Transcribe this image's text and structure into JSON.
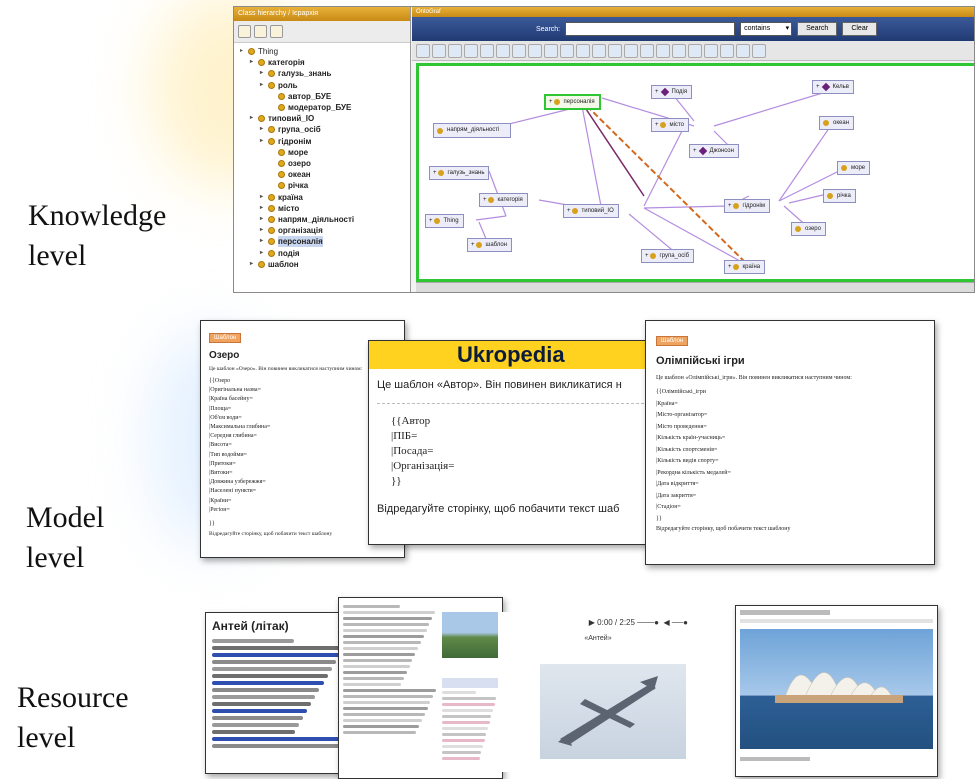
{
  "levels": {
    "knowledge": "Knowledge\nlevel",
    "model": "Model\nlevel",
    "resource": "Resource\nlevel"
  },
  "ontology_editor": {
    "tree_title": "Class hierarchy / Ієрархія",
    "graph_title": "OntoGraf",
    "tree": [
      {
        "label": "Thing",
        "depth": 0,
        "bold": false
      },
      {
        "label": "категорія",
        "depth": 1,
        "bold": true
      },
      {
        "label": "галузь_знань",
        "depth": 2,
        "bold": true
      },
      {
        "label": "роль",
        "depth": 2,
        "bold": true
      },
      {
        "label": "автор_БУЕ",
        "depth": 3,
        "bold": true
      },
      {
        "label": "модератор_БУЕ",
        "depth": 3,
        "bold": true
      },
      {
        "label": "типовий_IO",
        "depth": 1,
        "bold": true
      },
      {
        "label": "група_осіб",
        "depth": 2,
        "bold": true
      },
      {
        "label": "гідронім",
        "depth": 2,
        "bold": true
      },
      {
        "label": "море",
        "depth": 3,
        "bold": true
      },
      {
        "label": "озеро",
        "depth": 3,
        "bold": true
      },
      {
        "label": "океан",
        "depth": 3,
        "bold": true
      },
      {
        "label": "річка",
        "depth": 3,
        "bold": true
      },
      {
        "label": "країна",
        "depth": 2,
        "bold": true
      },
      {
        "label": "місто",
        "depth": 2,
        "bold": true
      },
      {
        "label": "напрям_діяльності",
        "depth": 2,
        "bold": true
      },
      {
        "label": "організація",
        "depth": 2,
        "bold": true
      },
      {
        "label": "персоналія",
        "depth": 2,
        "bold": true,
        "selected": true
      },
      {
        "label": "подія",
        "depth": 2,
        "bold": true
      },
      {
        "label": "шаблон",
        "depth": 1,
        "bold": true
      }
    ],
    "search_label": "Search:",
    "search_mode": "contains",
    "search_button": "Search",
    "clear_button": "Clear",
    "nodes": {
      "personalia": "персоналія",
      "podiya": "Подія",
      "kelvin": "Кельв",
      "napriam": "напрям_діяльності",
      "misto": "місто",
      "okean": "океан",
      "dzhonson": "Джонсон",
      "haluz": "галузь_знань",
      "more": "море",
      "kategoriya": "категорія",
      "typovyi": "типовий_IO",
      "richka": "річка",
      "thing": "Thing",
      "hidronim": "гідронім",
      "ozero": "озеро",
      "shablon": "шаблон",
      "hrupa": "група_осіб",
      "kraina": "країна"
    }
  },
  "templates": {
    "ozero": {
      "badge": "Шаблон",
      "title": "Озеро",
      "intro": "Це шаблон «Озеро». Він повинен викликатися наступним чином:",
      "lines": [
        "{{Озеро",
        "|Оригінальна назва=",
        "|Країна басейну=",
        "|Площа=",
        "|Об'єм води=",
        "|Максимальна глибина=",
        "|Середня глибина=",
        "|Висота=",
        "|Тип водойми=",
        "|Притоки=",
        "|Витоки=",
        "|Довжина узбережжя=",
        "|Населені пункти=",
        "|Країни=",
        "|Регіон="
      ],
      "close": "}}",
      "footer": "Відредагуйте сторінку, щоб побачити текст шаблону"
    },
    "avtor": {
      "banner": "Ukropedia",
      "intro": "Це шаблон «Автор». Він повинен викликатися н",
      "lines": [
        "{{Автор",
        "|ПІБ=",
        "|Посада=",
        "|Організація="
      ],
      "close": "}}",
      "footer": "Відредагуйте сторінку, щоб побачити текст шаб"
    },
    "olimp": {
      "badge": "Шаблон",
      "title": "Олімпійські ігри",
      "intro": "Це шаблон «Олімпійські_ігри». Він повинен викликатися наступним чином:",
      "lines": [
        "{{Олімпійські_ігри",
        "|Країна=",
        "|Місто-організатор=",
        "|Місто проведення=",
        "|Кількість країн-учасниць=",
        "|Кількість спортсменів=",
        "|Кількість видів спорту=",
        "|Рекордна кількість медалей=",
        "|Дата відкриття=",
        "|Дата закриття=",
        "|Стадіон="
      ],
      "close": "}}",
      "footer": "Відредагуйте сторінку, щоб побачити текст шаблону"
    }
  },
  "resources": {
    "antei_title": "Антей (літак)",
    "audio_time": "▶ 0:00 / 2:25",
    "audio_caption": "«Антей»"
  }
}
